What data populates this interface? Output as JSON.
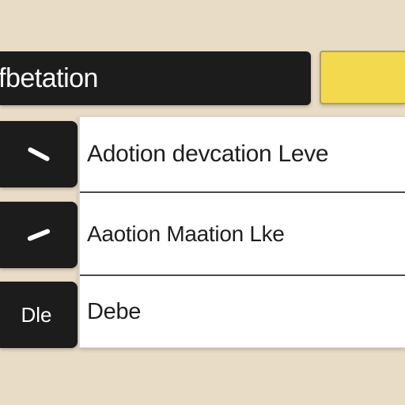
{
  "header": {
    "title": "fbetation"
  },
  "colors": {
    "background": "#e9dcc6",
    "dark": "#1c1c1c",
    "accent_yellow": "#f2d94e",
    "panel": "#ffffff"
  },
  "rows": [
    {
      "tab_icon": "minus-icon",
      "label": "Adotion devcation Leve"
    },
    {
      "tab_icon": "minus-icon",
      "label": "Aaotion Maation Lke"
    },
    {
      "tab_text": "Dle",
      "label": "Debe"
    }
  ]
}
